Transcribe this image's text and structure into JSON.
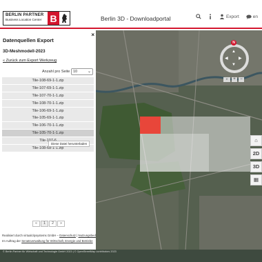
{
  "header": {
    "logo_line1": "BERLIN PARTNER",
    "logo_line2": "Business Location Center",
    "logo_b": "B",
    "title": "Berlin 3D - Downloadportal",
    "export_label": "Export",
    "lang_label": "en"
  },
  "panel": {
    "title": "Datenquellen Export",
    "close": "×",
    "subtitle": "3D-Meshmodell-2023",
    "back_link": "« Zurück zum Export Werkzeug",
    "per_page_label": "Anzahl pro Seite",
    "per_page_value": "10",
    "tiles": [
      "Tile-108-69-1-1.zip",
      "Tile-107-69-1-1.zip",
      "Tile-107-70-1-1.zip",
      "Tile-108-70-1-1.zip",
      "Tile-106-69-1-1.zip",
      "Tile-105-69-1-1.zip",
      "Tile-106-70-1-1.zip",
      "Tile-105-70-1-1.zip",
      "Tile-107-6",
      "Tile-108-68-1-1.zip"
    ],
    "tooltip": "Diese Datei herunterladen",
    "pager": {
      "prev": "«",
      "page1": "1",
      "page2": "2",
      "next": "»"
    }
  },
  "credits": {
    "line1_a": "Realisiert durch virtualcitysystems GmbH – ",
    "line1_b": "Datenschutz",
    "line1_c": " | ",
    "line1_d": "Nutzungsbedingungen",
    "line1_e": " | Impressum",
    "line2_a": "Im Auftrag der ",
    "line2_b": "Senatsverwaltung für Wirtschaft, Energie und Betriebe"
  },
  "map": {
    "north": "N",
    "zoom_in": "+",
    "zoom_out": "−",
    "home_btn": "⌂",
    "btn_2d": "2D",
    "btn_3d": "3D",
    "map_btn": "▦",
    "footer": "© Berlin Partner für Wirtschaft und Technologie GmbH 2023 | © OpenStreetMap contributors 2023"
  }
}
